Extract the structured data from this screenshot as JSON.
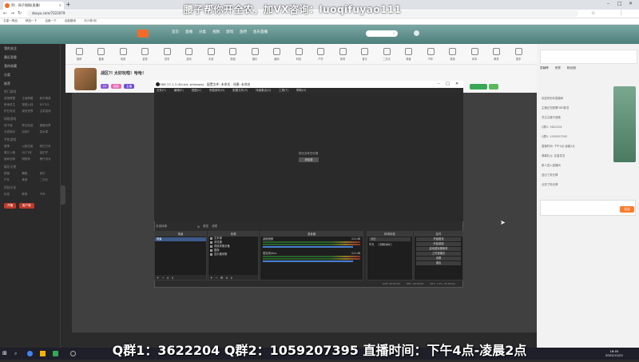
{
  "browser": {
    "tab_title": "乔i · 网子锅锅(直播)",
    "url": "douyu.com/7222079",
    "bookmarks": [
      "五星一等品",
      "精选一下",
      "百度一下",
      "百度翻译",
      "刘少聪·网"
    ],
    "new_tab": "+",
    "window_controls": [
      "–",
      "□",
      "✕"
    ]
  },
  "watermark": "腰子帮你开全农，加VX咨询：luoqifuyao111",
  "site": {
    "nav": [
      "首页",
      "直播",
      "分类",
      "视频",
      "游戏",
      "鱼吧",
      "鱼乐直播"
    ],
    "search_placeholder": "",
    "categories": [
      "推荐",
      "直播",
      "电竞",
      "星秀",
      "赛事",
      "游戏",
      "手游",
      "颜值",
      "娱乐",
      "趣玩",
      "科技",
      "户外",
      "体育",
      "音乐",
      "二次元",
      "美食",
      "汽车",
      "旅游",
      "军事",
      "教育",
      "更多"
    ],
    "sidebar": {
      "items": [
        "我的关注",
        "最近观看",
        "我的收藏",
        "分类",
        "推荐"
      ],
      "sections": [
        {
          "title": "热门游戏",
          "items": [
            "英雄联盟",
            "王者荣耀",
            "和平精英",
            "绝地求生",
            "穿越火线",
            "DOTA2",
            "炉石传说",
            "我的世界",
            "主机游戏"
          ]
        },
        {
          "title": "网络游戏",
          "items": [
            "地下城",
            "梦幻西游",
            "魔兽世界",
            "天涯明月",
            "剑网3",
            "逆水寒"
          ]
        },
        {
          "title": "手机游戏",
          "items": [
            "原神",
            "火影忍者",
            "明日方舟",
            "第五人格",
            "QQ飞车",
            "金铲铲",
            "使命召唤",
            "阴阳师",
            "蛋仔派对"
          ]
        },
        {
          "title": "娱乐天地",
          "items": [
            "颜值",
            "舞蹈",
            "音乐",
            "户外",
            "美食",
            "二次元"
          ]
        },
        {
          "title": "科技文化",
          "items": [
            "科技",
            "教育",
            "汽车"
          ]
        }
      ],
      "bottom_buttons": [
        "开播",
        "客户端"
      ]
    },
    "anchor": {
      "title": "战区?! 太好玩啦！哈哈！",
      "tags": [
        "LV",
        "战区",
        "主播"
      ]
    },
    "right_panel": {
      "tabs": [
        "贡献榜",
        "贵宾",
        "粉丝团"
      ],
      "chat": [
        "欢迎来到本直播间",
        "主播正在配置OBS推流",
        "关注主播不迷路",
        "Q群1: 3622204",
        "Q群2: 1059207395",
        "直播时间: 下午4点-凌晨2点",
        "弹幕礼仪: 友善发言",
        "新人进入直播间",
        "送出了荧光棒",
        "点亮了粉丝牌"
      ],
      "send_label": "发送"
    }
  },
  "obs": {
    "title": "OBS 27.1.3 (64-bit, windows) - 配置文件: 未命名 - 场景: 未命名",
    "menu": [
      "文件(F)",
      "编辑(E)",
      "视图(V)",
      "停靠部件(D)",
      "配置文件(P)",
      "场景集合(S)",
      "工具(T)",
      "帮助(H)"
    ],
    "no_source_text": "您还没有任何源",
    "add_source_btn": "添加源",
    "scene_bar": [
      "未选择源",
      "属性",
      "滤镜"
    ],
    "docks": {
      "scenes": {
        "title": "场景",
        "items": [
          "场景"
        ]
      },
      "sources": {
        "title": "来源",
        "items": [
          "文本源",
          "浏览器",
          "视频采集设备",
          "图像",
          "显示器采集"
        ]
      },
      "mixer": {
        "title": "混音器",
        "channels": [
          {
            "name": "桌面音频",
            "db": "0.0 dB"
          },
          {
            "name": "麦克风/Aux",
            "db": "0.0 dB"
          }
        ]
      },
      "transitions": {
        "title": "转场特效",
        "type": "淡出",
        "duration_label": "时长",
        "duration": "300 ms"
      },
      "controls": {
        "title": "控件",
        "buttons": [
          "开始推流",
          "开始录制",
          "启动虚拟摄像机",
          "工作室模式",
          "设置",
          "退出"
        ]
      }
    },
    "status": [
      "LIVE: 00:00:00",
      "REC: 00:00:00",
      "CPU: 1.2%, 30.00 fps"
    ]
  },
  "banner": "Q群1：3622204  Q群2：1059207395  直播时间：下午4点-凌晨2点",
  "taskbar": {
    "time": "16:05",
    "date": "2022/11/22"
  }
}
